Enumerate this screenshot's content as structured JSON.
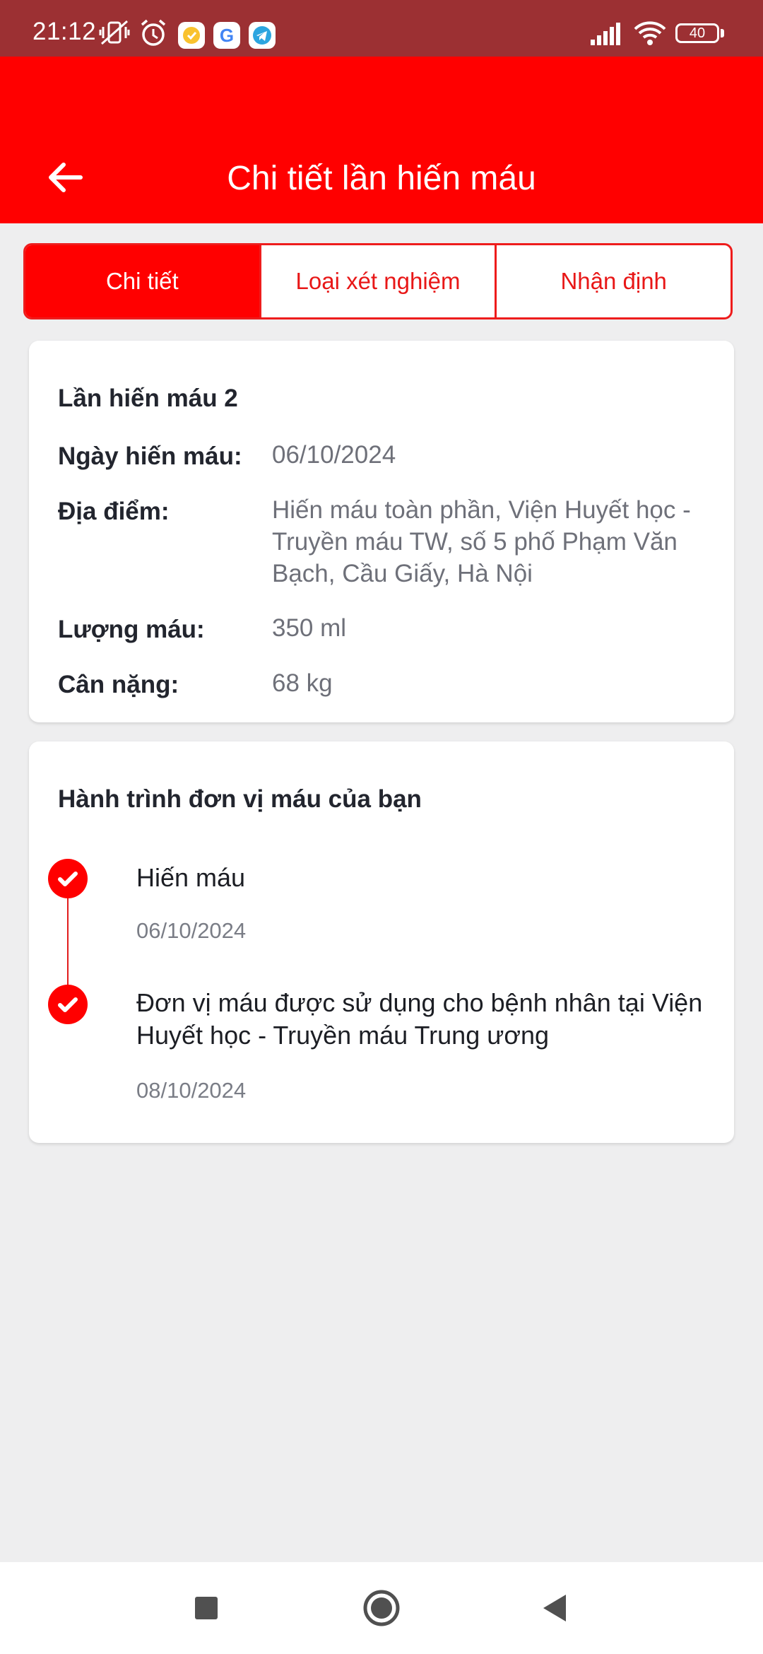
{
  "status_bar": {
    "time": "21:12",
    "battery": "40",
    "icons": [
      "vibrate-off-icon",
      "alarm-icon",
      "clock-app-icon",
      "google-icon",
      "telegram-icon",
      "signal-icon",
      "wifi-icon",
      "battery-icon"
    ]
  },
  "header": {
    "title": "Chi tiết lần hiến máu",
    "back_icon": "arrow-left-icon",
    "color": "#ff0000"
  },
  "tabs": [
    {
      "label": "Chi tiết",
      "active": true
    },
    {
      "label": "Loại xét nghiệm",
      "active": false
    },
    {
      "label": "Nhận định",
      "active": false
    }
  ],
  "details": {
    "heading": "Lần hiến máu 2",
    "rows": [
      {
        "label": "Ngày hiến máu:",
        "value": "06/10/2024"
      },
      {
        "label": "Địa điểm:",
        "value": "Hiến máu toàn phần, Viện Huyết học - Truyền máu TW, số 5 phố Phạm Văn Bạch, Cầu Giấy, Hà Nội"
      },
      {
        "label": "Lượng máu:",
        "value": "350 ml"
      },
      {
        "label": "Cân nặng:",
        "value": "68 kg"
      }
    ]
  },
  "journey": {
    "heading": "Hành trình đơn vị máu của bạn",
    "steps": [
      {
        "title": "Hiến máu",
        "date": "06/10/2024",
        "icon": "check-circle-icon"
      },
      {
        "title": "Đơn vị máu được sử dụng cho bệnh nhân tại Viện Huyết học - Truyền máu Trung ương",
        "date": "08/10/2024",
        "icon": "check-circle-icon"
      }
    ]
  },
  "nav": {
    "icons": [
      "recents-square-icon",
      "home-circle-icon",
      "back-triangle-icon"
    ]
  }
}
